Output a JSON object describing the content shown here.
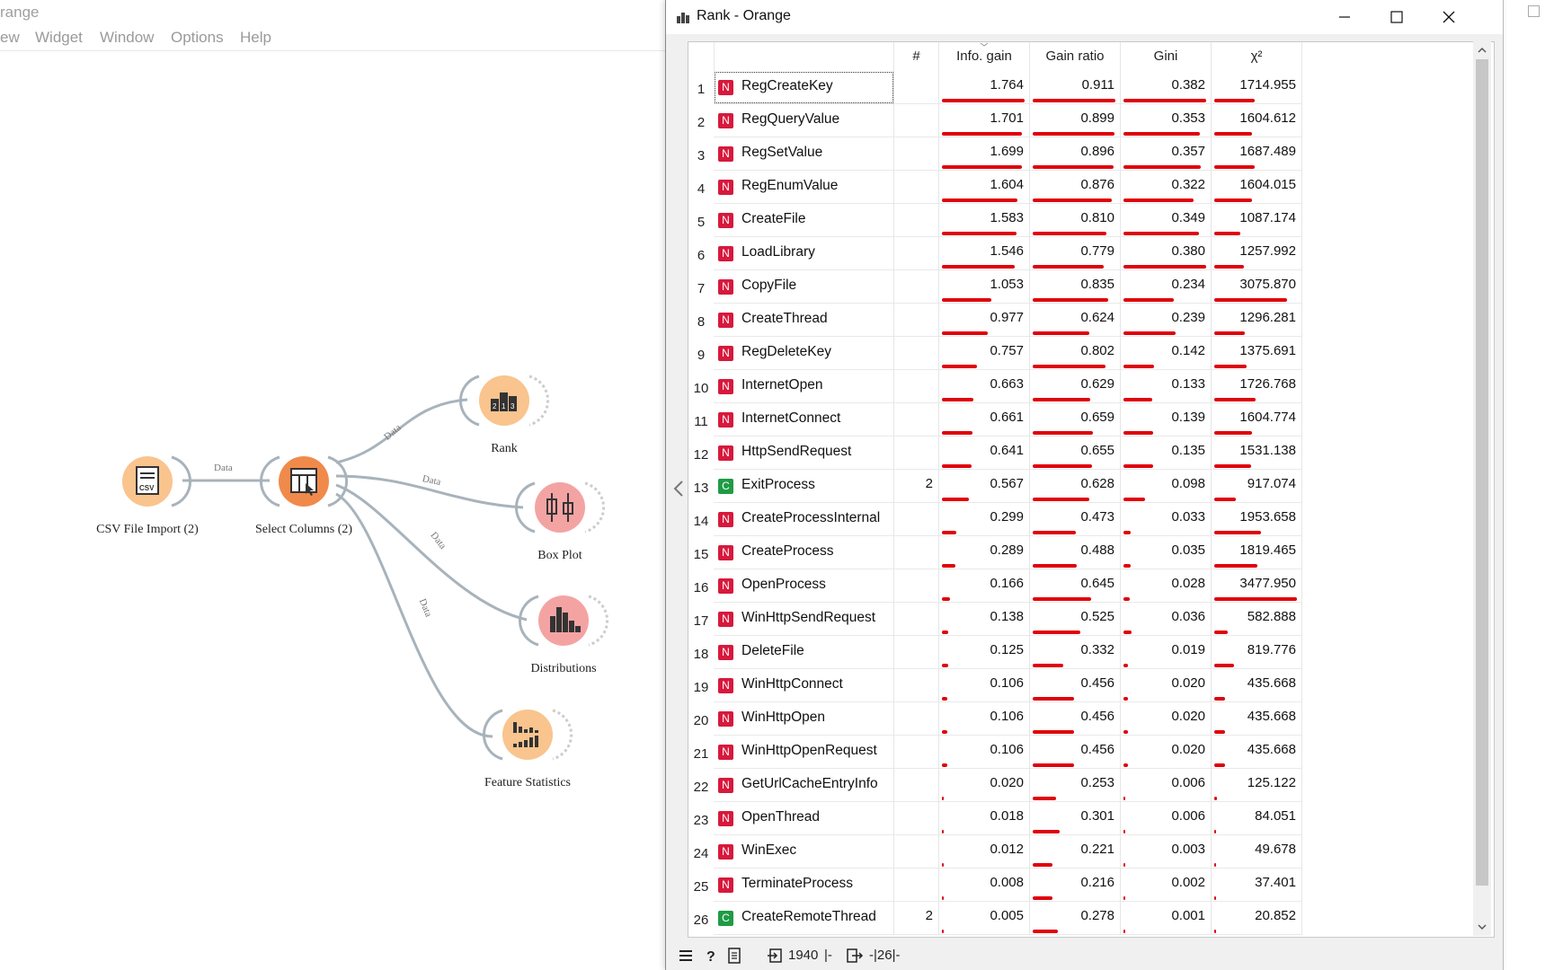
{
  "app": {
    "title": "range",
    "menu": [
      "ew",
      "Widget",
      "Window",
      "Options",
      "Help"
    ]
  },
  "workflow": {
    "nodes": [
      {
        "name": "csv-file-import-node",
        "label": "CSV File Import (2)",
        "icon": "csv-file-icon",
        "color": "#f9c48e"
      },
      {
        "name": "select-columns-node",
        "label": "Select Columns (2)",
        "icon": "select-columns-icon",
        "color": "#f08a4b"
      },
      {
        "name": "rank-node",
        "label": "Rank",
        "icon": "rank-icon",
        "color": "#f9c48e"
      },
      {
        "name": "box-plot-node",
        "label": "Box Plot",
        "icon": "box-plot-icon",
        "color": "#f4a3a3"
      },
      {
        "name": "distributions-node",
        "label": "Distributions",
        "icon": "distributions-icon",
        "color": "#f4a3a3"
      },
      {
        "name": "feature-statistics-node",
        "label": "Feature Statistics",
        "icon": "feature-statistics-icon",
        "color": "#f9c48e"
      }
    ],
    "links": [
      "Data",
      "Data",
      "Data",
      "Data",
      "Data"
    ]
  },
  "rank_window": {
    "title": "Rank - Orange",
    "columns": [
      "#",
      "Info. gain",
      "Gain ratio",
      "Gini",
      "χ²"
    ],
    "bar_color": "#e0000a",
    "type_colors": {
      "N": "#d7193c",
      "C": "#1f9b44"
    },
    "max": {
      "info_gain": 1.764,
      "gain_ratio": 0.911,
      "gini": 0.382,
      "chi2": 3477.95
    },
    "rows": [
      {
        "n": "1",
        "type": "N",
        "name": "RegCreateKey",
        "count": "",
        "ig": "1.764",
        "gr": "0.911",
        "gini": "0.382",
        "chi2": "1714.955"
      },
      {
        "n": "2",
        "type": "N",
        "name": "RegQueryValue",
        "count": "",
        "ig": "1.701",
        "gr": "0.899",
        "gini": "0.353",
        "chi2": "1604.612"
      },
      {
        "n": "3",
        "type": "N",
        "name": "RegSetValue",
        "count": "",
        "ig": "1.699",
        "gr": "0.896",
        "gini": "0.357",
        "chi2": "1687.489"
      },
      {
        "n": "4",
        "type": "N",
        "name": "RegEnumValue",
        "count": "",
        "ig": "1.604",
        "gr": "0.876",
        "gini": "0.322",
        "chi2": "1604.015"
      },
      {
        "n": "5",
        "type": "N",
        "name": "CreateFile",
        "count": "",
        "ig": "1.583",
        "gr": "0.810",
        "gini": "0.349",
        "chi2": "1087.174"
      },
      {
        "n": "6",
        "type": "N",
        "name": "LoadLibrary",
        "count": "",
        "ig": "1.546",
        "gr": "0.779",
        "gini": "0.380",
        "chi2": "1257.992"
      },
      {
        "n": "7",
        "type": "N",
        "name": "CopyFile",
        "count": "",
        "ig": "1.053",
        "gr": "0.835",
        "gini": "0.234",
        "chi2": "3075.870"
      },
      {
        "n": "8",
        "type": "N",
        "name": "CreateThread",
        "count": "",
        "ig": "0.977",
        "gr": "0.624",
        "gini": "0.239",
        "chi2": "1296.281"
      },
      {
        "n": "9",
        "type": "N",
        "name": "RegDeleteKey",
        "count": "",
        "ig": "0.757",
        "gr": "0.802",
        "gini": "0.142",
        "chi2": "1375.691"
      },
      {
        "n": "10",
        "type": "N",
        "name": "InternetOpen",
        "count": "",
        "ig": "0.663",
        "gr": "0.629",
        "gini": "0.133",
        "chi2": "1726.768"
      },
      {
        "n": "11",
        "type": "N",
        "name": "InternetConnect",
        "count": "",
        "ig": "0.661",
        "gr": "0.659",
        "gini": "0.139",
        "chi2": "1604.774"
      },
      {
        "n": "12",
        "type": "N",
        "name": "HttpSendRequest",
        "count": "",
        "ig": "0.641",
        "gr": "0.655",
        "gini": "0.135",
        "chi2": "1531.138"
      },
      {
        "n": "13",
        "type": "C",
        "name": "ExitProcess",
        "count": "2",
        "ig": "0.567",
        "gr": "0.628",
        "gini": "0.098",
        "chi2": "917.074"
      },
      {
        "n": "14",
        "type": "N",
        "name": "CreateProcessInternal",
        "count": "",
        "ig": "0.299",
        "gr": "0.473",
        "gini": "0.033",
        "chi2": "1953.658"
      },
      {
        "n": "15",
        "type": "N",
        "name": "CreateProcess",
        "count": "",
        "ig": "0.289",
        "gr": "0.488",
        "gini": "0.035",
        "chi2": "1819.465"
      },
      {
        "n": "16",
        "type": "N",
        "name": "OpenProcess",
        "count": "",
        "ig": "0.166",
        "gr": "0.645",
        "gini": "0.028",
        "chi2": "3477.950"
      },
      {
        "n": "17",
        "type": "N",
        "name": "WinHttpSendRequest",
        "count": "",
        "ig": "0.138",
        "gr": "0.525",
        "gini": "0.036",
        "chi2": "582.888"
      },
      {
        "n": "18",
        "type": "N",
        "name": "DeleteFile",
        "count": "",
        "ig": "0.125",
        "gr": "0.332",
        "gini": "0.019",
        "chi2": "819.776"
      },
      {
        "n": "19",
        "type": "N",
        "name": "WinHttpConnect",
        "count": "",
        "ig": "0.106",
        "gr": "0.456",
        "gini": "0.020",
        "chi2": "435.668"
      },
      {
        "n": "20",
        "type": "N",
        "name": "WinHttpOpen",
        "count": "",
        "ig": "0.106",
        "gr": "0.456",
        "gini": "0.020",
        "chi2": "435.668"
      },
      {
        "n": "21",
        "type": "N",
        "name": "WinHttpOpenRequest",
        "count": "",
        "ig": "0.106",
        "gr": "0.456",
        "gini": "0.020",
        "chi2": "435.668"
      },
      {
        "n": "22",
        "type": "N",
        "name": "GetUrlCacheEntryInfo",
        "count": "",
        "ig": "0.020",
        "gr": "0.253",
        "gini": "0.006",
        "chi2": "125.122"
      },
      {
        "n": "23",
        "type": "N",
        "name": "OpenThread",
        "count": "",
        "ig": "0.018",
        "gr": "0.301",
        "gini": "0.006",
        "chi2": "84.051"
      },
      {
        "n": "24",
        "type": "N",
        "name": "WinExec",
        "count": "",
        "ig": "0.012",
        "gr": "0.221",
        "gini": "0.003",
        "chi2": "49.678"
      },
      {
        "n": "25",
        "type": "N",
        "name": "TerminateProcess",
        "count": "",
        "ig": "0.008",
        "gr": "0.216",
        "gini": "0.002",
        "chi2": "37.401"
      },
      {
        "n": "26",
        "type": "C",
        "name": "CreateRemoteThread",
        "count": "2",
        "ig": "0.005",
        "gr": "0.278",
        "gini": "0.001",
        "chi2": "20.852"
      }
    ],
    "status": {
      "input": "1940",
      "input_sep": "|-",
      "output": "-|26|-"
    }
  }
}
